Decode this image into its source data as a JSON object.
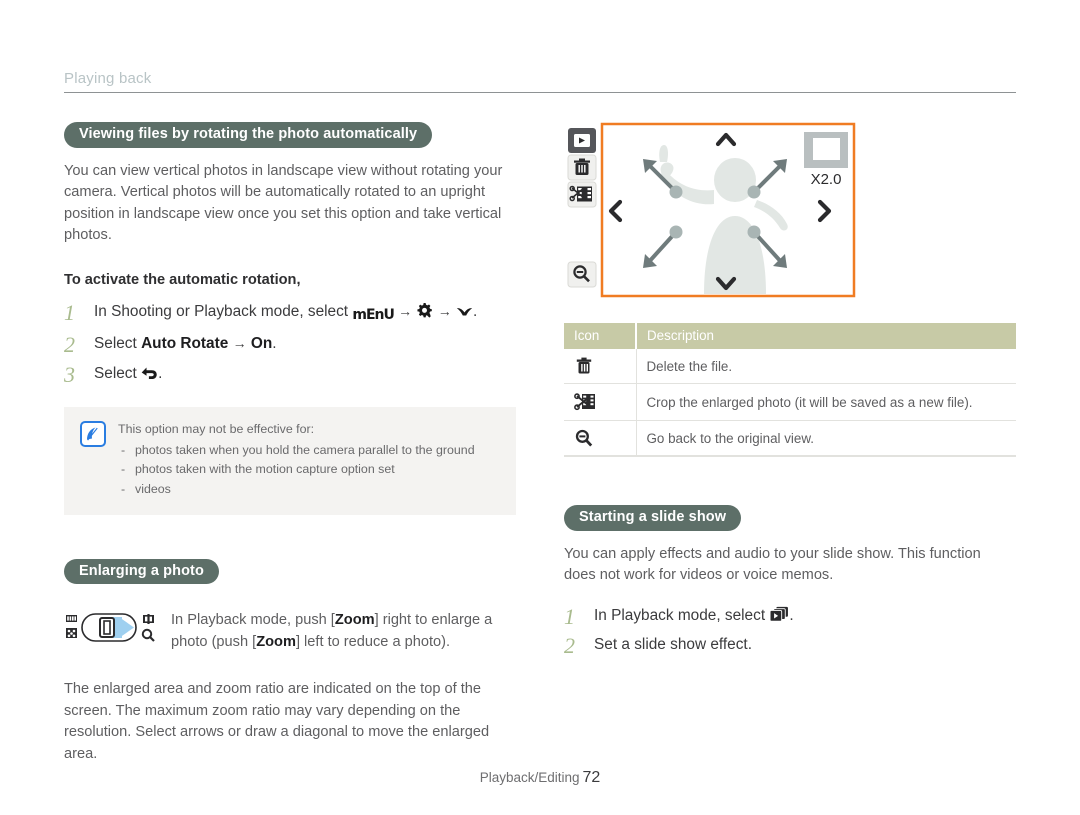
{
  "running_head": "Playing back",
  "footer": {
    "section": "Playback/Editing",
    "page_number": "72"
  },
  "colors": {
    "pill_bg": "#5d6f68",
    "table_header_bg": "#c7caa6",
    "step_number": "#a9bb8e",
    "note_icon_border": "#2a7de1",
    "screen_border": "#f07c22",
    "body_text": "#5e5e60"
  },
  "left_column": {
    "section_title": "Viewing files by rotating the photo automatically",
    "intro_paragraph": "You can view vertical photos in landscape view without rotating your camera. Vertical photos will be automatically rotated to an upright position in landscape view once you set this option and take vertical photos.",
    "sub_heading": "To activate the automatic rotation,",
    "steps": [
      {
        "number": "1",
        "text_before": "In Shooting or Playback mode, select",
        "icons": [
          "menu-icon",
          "settings-gear-icon",
          "chevron-down-icon"
        ],
        "arrow": "→",
        "text_after": "."
      },
      {
        "number": "2",
        "text_before": "Select",
        "bold_1": "Auto Rotate",
        "arrow": "→",
        "bold_2": "On",
        "text_after": "."
      },
      {
        "number": "3",
        "text_before": "Select",
        "icons": [
          "back-arrow-icon"
        ],
        "text_after": "."
      }
    ],
    "note": {
      "icon": "note-pen-icon",
      "title": "This option may not be effective for:",
      "items": [
        "photos taken when you hold the camera parallel to the ground",
        "photos taken with the motion capture option set",
        "videos"
      ]
    },
    "enlarging": {
      "section_title": "Enlarging a photo",
      "figure": "zoom-lever-icon",
      "instruction_1_before": "In Playback mode, push [",
      "instruction_1_key": "Zoom",
      "instruction_1_middle": "] right to enlarge a photo (push [",
      "instruction_1_key2": "Zoom",
      "instruction_1_after": "] left to reduce a photo).",
      "paragraph": "The enlarged area and zoom ratio are indicated on the top of the screen. The maximum zoom ratio may vary depending on the resolution. Select arrows or draw a diagonal to move the enlarged area."
    }
  },
  "right_column": {
    "camera_screen": {
      "zoom_ratio_label": "X2.0",
      "side_icons": [
        "play-icon",
        "trash-icon",
        "crop-film-icon",
        "zoom-out-icon"
      ],
      "nav_arrows": [
        "up-chevron-icon",
        "down-chevron-icon",
        "left-chevron-icon",
        "right-chevron-icon"
      ],
      "drag_arrows": [
        "up-left-arrow",
        "up-right-arrow",
        "down-left-arrow",
        "down-right-arrow"
      ]
    },
    "table": {
      "headers": [
        "Icon",
        "Description"
      ],
      "rows": [
        {
          "icon": "trash-icon",
          "description": "Delete the file."
        },
        {
          "icon": "crop-film-icon",
          "description": "Crop the enlarged photo (it will be saved as a new file)."
        },
        {
          "icon": "zoom-out-icon",
          "description": "Go back to the original view."
        }
      ]
    },
    "slideshow": {
      "section_title": "Starting a slide show",
      "paragraph": "You can apply effects and audio to your slide show. This function does not work for videos or voice memos.",
      "steps": [
        {
          "number": "1",
          "text_before": "In Playback mode, select",
          "icons": [
            "slideshow-icon"
          ],
          "text_after": "."
        },
        {
          "number": "2",
          "text_before": "Set a slide show effect.",
          "icons": [],
          "text_after": ""
        }
      ]
    }
  }
}
